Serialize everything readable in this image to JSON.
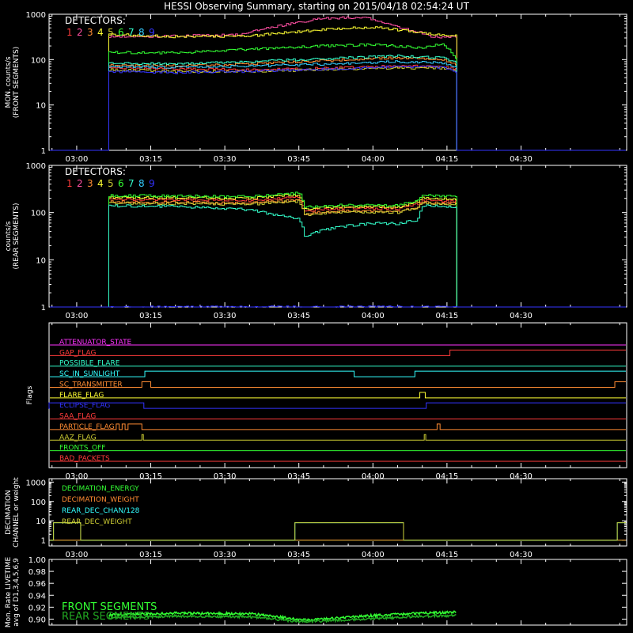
{
  "title": "HESSI Observing Summary, starting on 2015/04/18 02:54:24 UT",
  "colors": {
    "background": "#000000",
    "axes": "#ffffff",
    "det1": "#ff3b3b",
    "det2": "#ff4fa3",
    "det3": "#ff8c33",
    "det4": "#ffff33",
    "det5": "#cccc33",
    "det6": "#33ff33",
    "det7": "#33ffcc",
    "det8": "#33ccff",
    "det9": "#3333ff"
  },
  "x_axis": {
    "tick_labels": [
      "03:00",
      "03:15",
      "03:30",
      "03:45",
      "04:00",
      "04:15",
      "04:30"
    ],
    "tick_minutes": [
      180,
      195,
      210,
      225,
      240,
      255,
      270
    ],
    "range_minutes": [
      174.4,
      291.4
    ]
  },
  "legend": {
    "label": "DETECTORS:",
    "numbers": [
      "1",
      "2",
      "3",
      "4",
      "5",
      "6",
      "7",
      "8",
      "9"
    ]
  },
  "chart_data": [
    {
      "type": "line",
      "id": "front",
      "ylabel": "MON. counts/s",
      "ylabel2": "(FRONT SEGMENTS)",
      "yscale": "log",
      "ylim": [
        1,
        1000
      ],
      "ytick_labels": [
        "1",
        "10",
        "100",
        "1000"
      ],
      "observation_minutes": [
        186.5,
        257.0
      ],
      "series": [
        {
          "name": "1",
          "color_key": "det1",
          "x": [
            186.5,
            200,
            215,
            225,
            240,
            250,
            254,
            257
          ],
          "y": [
            65,
            62,
            60,
            62,
            70,
            72,
            70,
            60
          ]
        },
        {
          "name": "2",
          "color_key": "det2",
          "x": [
            186.5,
            200,
            213,
            220,
            230,
            238,
            245,
            252,
            257
          ],
          "y": [
            320,
            330,
            360,
            520,
            820,
            850,
            520,
            320,
            310
          ]
        },
        {
          "name": "3",
          "color_key": "det3",
          "x": [
            186.5,
            200,
            215,
            230,
            245,
            254,
            257
          ],
          "y": [
            75,
            73,
            80,
            95,
            110,
            100,
            75
          ]
        },
        {
          "name": "4",
          "color_key": "det4",
          "x": [
            186.5,
            200,
            215,
            230,
            240,
            250,
            257
          ],
          "y": [
            360,
            320,
            330,
            460,
            520,
            380,
            340
          ]
        },
        {
          "name": "5",
          "color_key": "det5",
          "x": [
            186.5,
            200,
            215,
            230,
            245,
            254,
            257
          ],
          "y": [
            60,
            55,
            55,
            60,
            65,
            65,
            55
          ]
        },
        {
          "name": "6",
          "color_key": "det6",
          "x": [
            186.5,
            200,
            215,
            230,
            240,
            250,
            254,
            257
          ],
          "y": [
            145,
            140,
            170,
            200,
            215,
            180,
            220,
            95
          ]
        },
        {
          "name": "7",
          "color_key": "det7",
          "x": [
            186.5,
            200,
            215,
            230,
            245,
            254,
            257
          ],
          "y": [
            85,
            80,
            90,
            105,
            120,
            110,
            85
          ]
        },
        {
          "name": "8",
          "color_key": "det8",
          "x": [
            186.5,
            200,
            215,
            230,
            245,
            254,
            257
          ],
          "y": [
            70,
            68,
            72,
            80,
            90,
            85,
            65
          ]
        },
        {
          "name": "9",
          "color_key": "det9",
          "x": [
            186.5,
            200,
            215,
            230,
            245,
            254,
            257
          ],
          "y": [
            55,
            52,
            55,
            62,
            70,
            68,
            50
          ]
        }
      ]
    },
    {
      "type": "line",
      "id": "rear",
      "ylabel": "counts/s",
      "ylabel2": "(REAR SEGMENTS)",
      "yscale": "log",
      "ylim": [
        1,
        1000
      ],
      "ytick_labels": [
        "1",
        "10",
        "100",
        "1000"
      ],
      "observation_minutes": [
        186.5,
        257.0
      ],
      "series": [
        {
          "name": "1",
          "color_key": "det1",
          "x": [
            186.5,
            200,
            215,
            225,
            226,
            235,
            245,
            249,
            250,
            257
          ],
          "y": [
            190,
            185,
            180,
            210,
            110,
            125,
            120,
            150,
            185,
            170
          ]
        },
        {
          "name": "3",
          "color_key": "det3",
          "x": [
            186.5,
            200,
            215,
            225,
            226,
            235,
            245,
            249,
            250,
            257
          ],
          "y": [
            170,
            165,
            160,
            185,
            95,
            110,
            105,
            130,
            165,
            155
          ]
        },
        {
          "name": "4",
          "color_key": "det4",
          "x": [
            186.5,
            200,
            215,
            225,
            226,
            235,
            245,
            249,
            250,
            257
          ],
          "y": [
            210,
            205,
            200,
            240,
            120,
            135,
            130,
            165,
            205,
            190
          ]
        },
        {
          "name": "5",
          "color_key": "det5",
          "x": [
            186.5,
            200,
            215,
            225,
            226,
            235,
            245,
            249,
            250,
            257
          ],
          "y": [
            160,
            155,
            150,
            175,
            90,
            105,
            100,
            125,
            160,
            150
          ]
        },
        {
          "name": "6",
          "color_key": "det6",
          "x": [
            186.5,
            200,
            215,
            225,
            226,
            235,
            245,
            249,
            250,
            257
          ],
          "y": [
            230,
            225,
            220,
            260,
            130,
            145,
            140,
            180,
            230,
            220
          ]
        },
        {
          "name": "7",
          "color_key": "det7",
          "x": [
            186.5,
            200,
            215,
            220,
            225,
            226,
            233,
            240,
            245,
            249,
            250,
            257
          ],
          "y": [
            140,
            135,
            115,
            90,
            75,
            32,
            50,
            60,
            58,
            70,
            140,
            130
          ]
        },
        {
          "name": "9",
          "color_key": "det9",
          "x": [
            186.5,
            257
          ],
          "y": [
            1,
            1
          ]
        }
      ]
    },
    {
      "type": "line",
      "id": "flags",
      "ylabel": "Flags",
      "flags": [
        {
          "label": "ATTENUATOR_STATE",
          "color": "#ff33ff",
          "high": []
        },
        {
          "label": "GAP_FLAG",
          "color": "#ff3b3b",
          "high": [
            [
              255.6,
              291.4
            ]
          ]
        },
        {
          "label": "POSSIBLE_FLARE",
          "color": "#33ffcc",
          "high": []
        },
        {
          "label": "SC_IN_SUNLIGHT",
          "color": "#33ffff",
          "high": [
            [
              193.8,
              236.2
            ],
            [
              248.5,
              291.4
            ]
          ]
        },
        {
          "label": "SC_TRANSMITTER",
          "color": "#ff8c33",
          "high": [
            [
              193.2,
              195.0
            ],
            [
              289.0,
              291.4
            ]
          ]
        },
        {
          "label": "FLARE_FLAG",
          "color": "#ffff33",
          "high": [
            [
              249.5,
              250.6
            ]
          ]
        },
        {
          "label": "ECLIPSE_FLAG",
          "color": "#3333ff",
          "high": [
            [
              174.4,
              193.6
            ],
            [
              250.8,
              291.4
            ]
          ]
        },
        {
          "label": "SAA_FLAG",
          "color": "#ff3b3b",
          "high": []
        },
        {
          "label": "PARTICLE_FLAG",
          "color": "#ff8c33",
          "high": [
            [
              188.0,
              188.6
            ],
            [
              189.2,
              189.8
            ],
            [
              190.4,
              193.2
            ],
            [
              253.0,
              253.6
            ]
          ]
        },
        {
          "label": "AAZ_FLAG",
          "color": "#cccc33",
          "high": [
            [
              193.2,
              193.5
            ],
            [
              250.4,
              250.7
            ]
          ]
        },
        {
          "label": "FRONTS_OFF",
          "color": "#33ff33",
          "high": []
        },
        {
          "label": "BAD_PACKETS",
          "color": "#ff3b3b",
          "high": []
        }
      ]
    },
    {
      "type": "line",
      "id": "decimation",
      "ylabel": "DECIMATION",
      "ylabel2": "CHANNEL or weight",
      "yscale": "log",
      "ylim": [
        0.5,
        1500
      ],
      "ytick_labels": [
        "1",
        "10",
        "100",
        "1000"
      ],
      "series": [
        {
          "name": "DECIMATION_ENERGY",
          "color": "#33ff33",
          "baseline": 1,
          "steps": []
        },
        {
          "name": "DECIMATION_WEIGHT",
          "color": "#ff8c33",
          "baseline": 1,
          "steps": []
        },
        {
          "name": "REAR_DEC_CHAN/128",
          "color": "#33ffff",
          "baseline": 1,
          "steps": [
            [
              175.3,
              180.8,
              8
            ],
            [
              224.2,
              246.2,
              8
            ],
            [
              289.5,
              291.4,
              8
            ]
          ]
        },
        {
          "name": "REAR_DEC_WEIGHT",
          "color": "#cccc33",
          "baseline": 1,
          "steps": [
            [
              175.3,
              180.8,
              8
            ],
            [
              224.2,
              246.2,
              8
            ],
            [
              289.5,
              291.4,
              8
            ]
          ]
        }
      ]
    },
    {
      "type": "line",
      "id": "livetime",
      "ylabel": "Mon. Rate LIVETIME",
      "ylabel2": "avg of D1,3,4,5,6,9",
      "ylim": [
        0.89,
        1.0
      ],
      "ytick_labels": [
        "0.90",
        "0.92",
        "0.94",
        "0.96",
        "0.98",
        "1.00"
      ],
      "series": [
        {
          "name": "FRONT SEGMENTS",
          "color": "#33ff33",
          "x": [
            186.5,
            200,
            215,
            220,
            225,
            230,
            240,
            250,
            257
          ],
          "y": [
            0.907,
            0.91,
            0.909,
            0.905,
            0.899,
            0.9,
            0.906,
            0.91,
            0.912
          ]
        },
        {
          "name": "REAR SEGMENTS",
          "color": "#22aa22",
          "x": [
            186.5,
            200,
            215,
            220,
            225,
            230,
            240,
            250,
            257
          ],
          "y": [
            0.902,
            0.905,
            0.904,
            0.9,
            0.896,
            0.897,
            0.901,
            0.905,
            0.906
          ]
        }
      ]
    }
  ]
}
